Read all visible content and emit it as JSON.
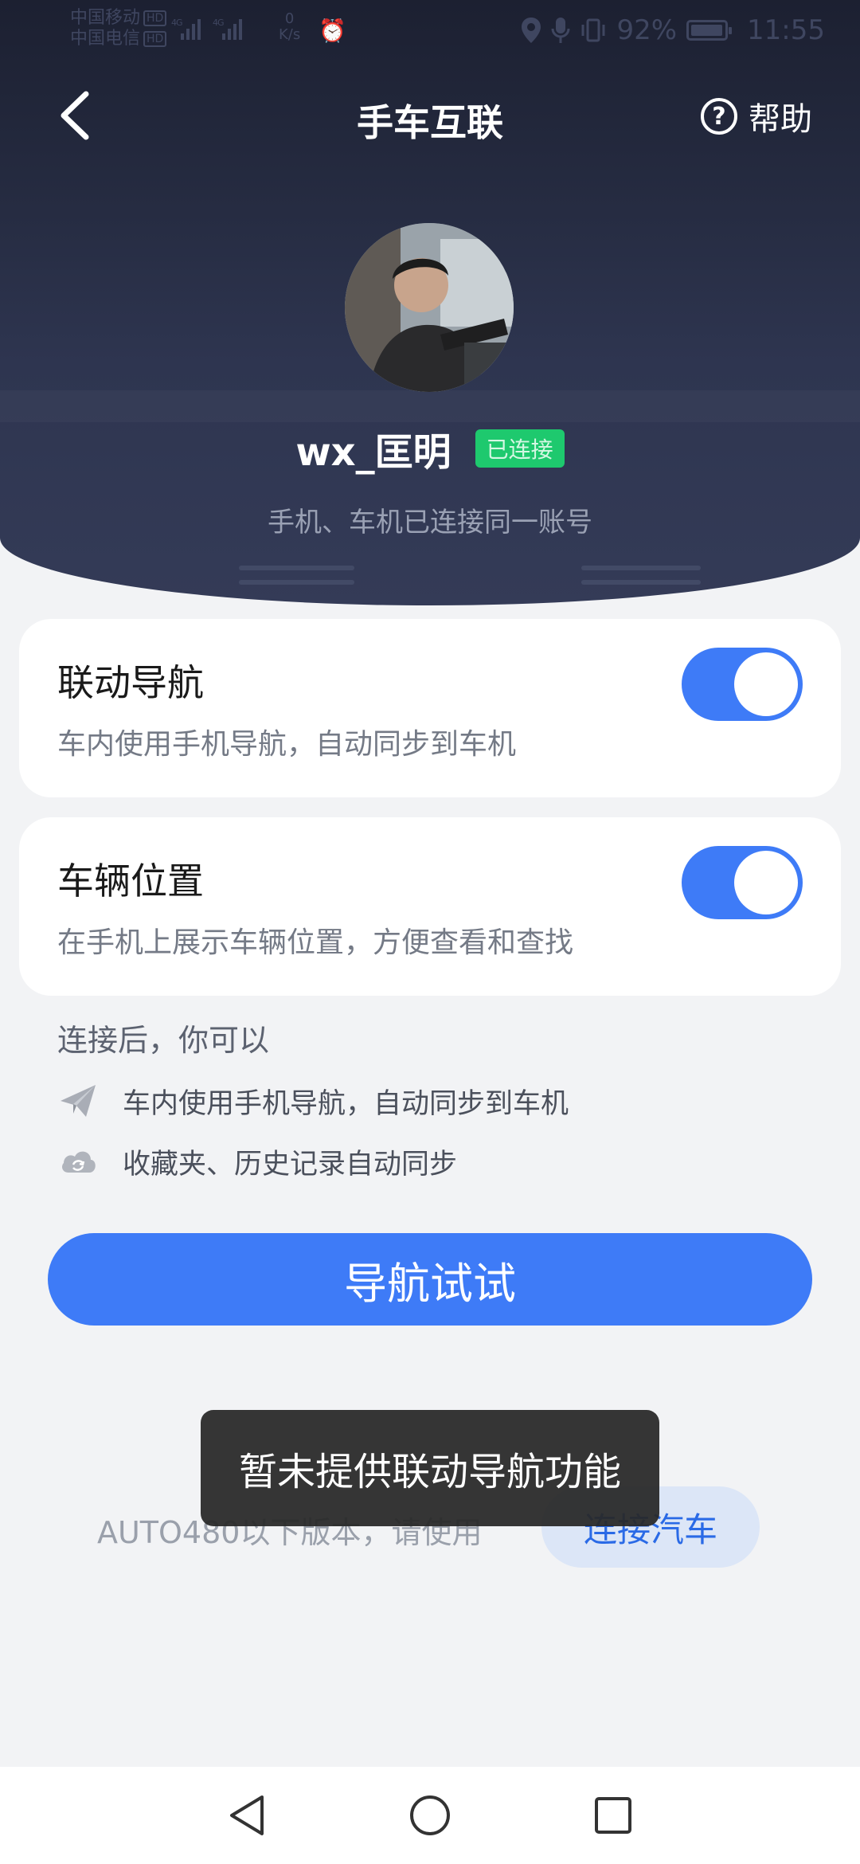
{
  "status_bar": {
    "carrier_1": "中国移动",
    "carrier_2": "中国电信",
    "hd": "HD",
    "net_type": "4G",
    "net_speed_value": "0",
    "net_speed_unit": "K/s",
    "battery": "92%",
    "time": "11:55"
  },
  "header": {
    "title": "手车互联",
    "help_label": "帮助"
  },
  "profile": {
    "username": "wx_匡明",
    "badge": "已连接",
    "subtitle": "手机、车机已连接同一账号"
  },
  "cards": [
    {
      "title": "联动导航",
      "desc": "车内使用手机导航，自动同步到车机",
      "toggle_on": true
    },
    {
      "title": "车辆位置",
      "desc": "在手机上展示车辆位置，方便查看和查找",
      "toggle_on": true
    }
  ],
  "features": {
    "label": "连接后，你可以",
    "items": [
      {
        "icon": "paper-plane-icon",
        "text": "车内使用手机导航，自动同步到车机"
      },
      {
        "icon": "cloud-sync-icon",
        "text": "收藏夹、历史记录自动同步"
      }
    ]
  },
  "primary_button": "导航试试",
  "legacy": {
    "notice": "AUTO480以下版本，请使用",
    "connect_button": "连接汽车"
  },
  "toast": "暂未提供联动导航功能",
  "colors": {
    "accent": "#3e7bf7",
    "badge_green": "#1ec96e",
    "header_dark": "#1c2031"
  }
}
